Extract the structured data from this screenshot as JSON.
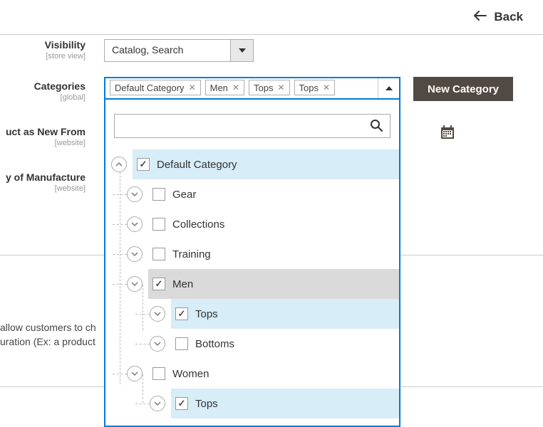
{
  "header": {
    "back": "Back"
  },
  "fields": {
    "visibility": {
      "label": "Visibility",
      "scope": "[store view]",
      "value": "Catalog, Search"
    },
    "categories": {
      "label": "Categories",
      "scope": "[global]"
    },
    "newfrom": {
      "label": "uct as New From",
      "scope": "[website]"
    },
    "country": {
      "label": "y of Manufacture",
      "scope": "[website]"
    }
  },
  "chips": [
    {
      "label": "Default Category"
    },
    {
      "label": "Men"
    },
    {
      "label": "Tops"
    },
    {
      "label": "Tops"
    }
  ],
  "tree": {
    "n0": "Default Category",
    "n1": "Gear",
    "n2": "Collections",
    "n3": "Training",
    "n4": "Men",
    "n5": "Tops",
    "n6": "Bottoms",
    "n7": "Women",
    "n8": "Tops"
  },
  "buttons": {
    "new_category": "New Category"
  },
  "blurb": {
    "l1": "allow customers to ch",
    "l2": "uration (Ex: a product"
  }
}
